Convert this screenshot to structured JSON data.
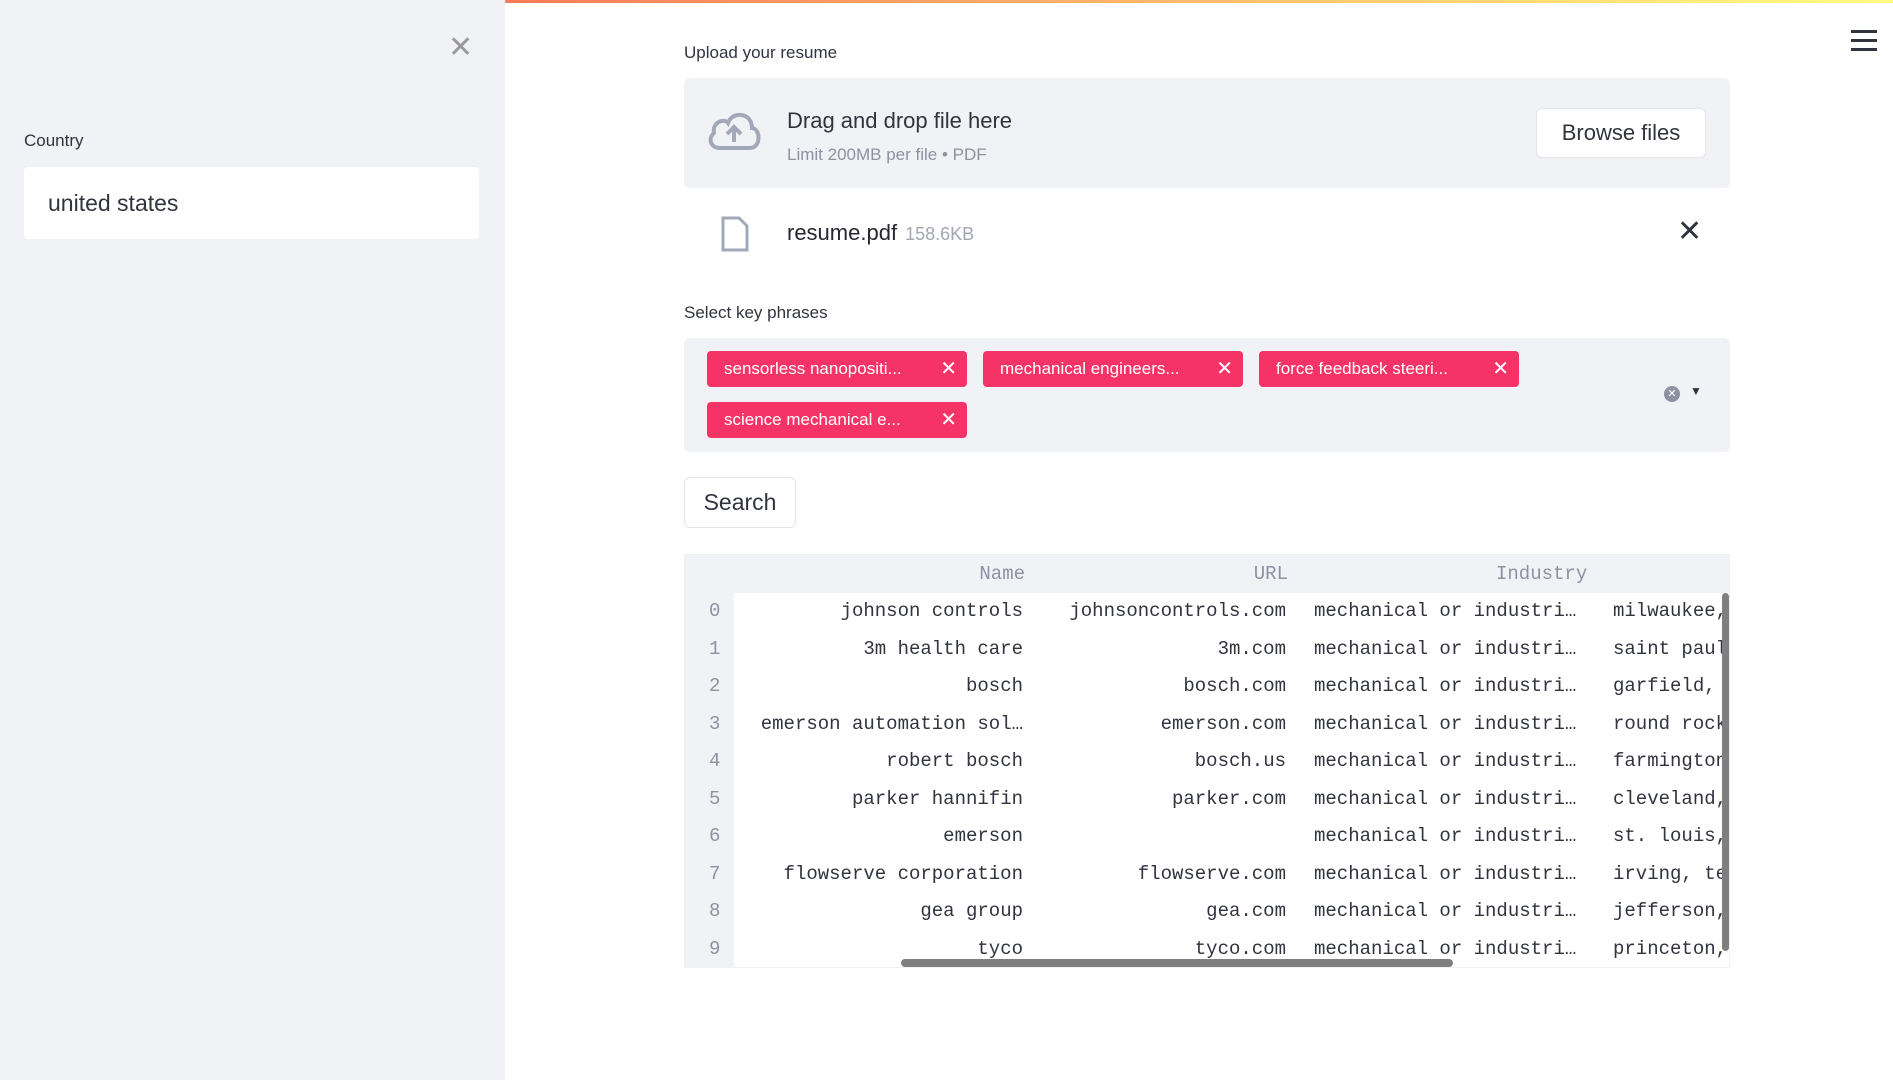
{
  "sidebar": {
    "close_icon": "close-icon",
    "country_label": "Country",
    "country_value": "united states"
  },
  "upload": {
    "label": "Upload your resume",
    "drop_title": "Drag and drop file here",
    "drop_sub": "Limit 200MB per file • PDF",
    "browse": "Browse files",
    "file_name": "resume.pdf",
    "file_size": "158.6KB"
  },
  "keyphrases": {
    "label": "Select key phrases",
    "tags": [
      "sensorless nanopositi...",
      "mechanical engineers...",
      "force feedback steeri...",
      "science mechanical e..."
    ]
  },
  "search_label": "Search",
  "table": {
    "headers": [
      "Name",
      "URL",
      "Industry"
    ],
    "rows": [
      [
        "0",
        "johnson controls",
        "johnsoncontrols.com",
        "mechanical or industri…",
        "milwaukee,"
      ],
      [
        "1",
        "3m health care",
        "3m.com",
        "mechanical or industri…",
        "saint paul"
      ],
      [
        "2",
        "bosch",
        "bosch.com",
        "mechanical or industri…",
        "garfield,"
      ],
      [
        "3",
        "emerson automation sol…",
        "emerson.com",
        "mechanical or industri…",
        "round rock"
      ],
      [
        "4",
        "robert bosch",
        "bosch.us",
        "mechanical or industri…",
        "farmington"
      ],
      [
        "5",
        "parker hannifin",
        "parker.com",
        "mechanical or industri…",
        "cleveland,"
      ],
      [
        "6",
        "emerson",
        "",
        "mechanical or industri…",
        "st. louis,"
      ],
      [
        "7",
        "flowserve corporation",
        "flowserve.com",
        "mechanical or industri…",
        "irving, te"
      ],
      [
        "8",
        "gea group",
        "gea.com",
        "mechanical or industri…",
        "jefferson,"
      ],
      [
        "9",
        "tyco",
        "tyco.com",
        "mechanical or industri…",
        "princeton,"
      ]
    ]
  }
}
